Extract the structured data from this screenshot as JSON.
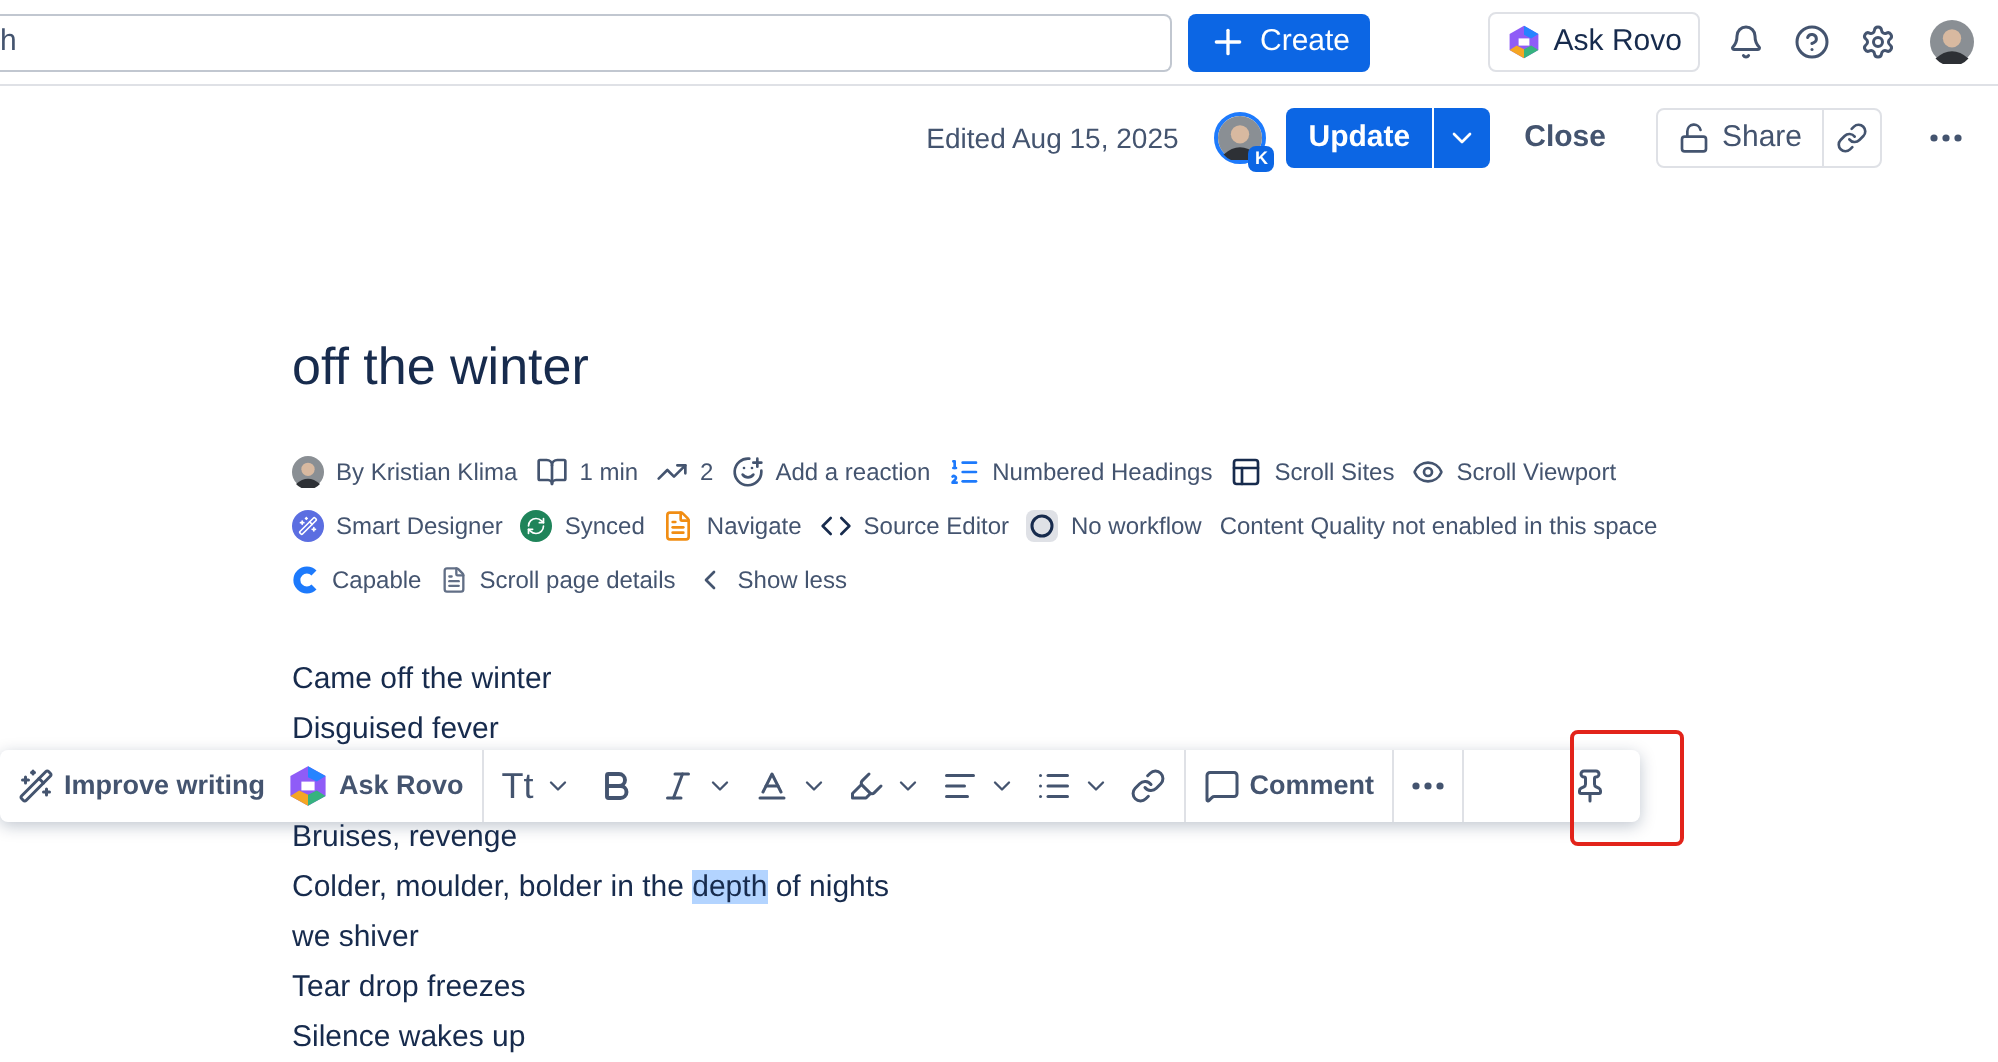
{
  "topbar": {
    "search": {
      "value": "h"
    },
    "create": "Create",
    "ask_rovo": "Ask Rovo"
  },
  "page_actions": {
    "edited": "Edited Aug 15, 2025",
    "avatar_badge": "K",
    "update": "Update",
    "close": "Close",
    "share": "Share"
  },
  "title": "off the winter",
  "meta_rows": [
    [
      {
        "kind": "avatar",
        "label": "By Kristian Klima"
      },
      {
        "kind": "read-time",
        "label": "1 min"
      },
      {
        "kind": "views",
        "label": "2"
      },
      {
        "kind": "reaction",
        "label": "Add a reaction"
      },
      {
        "kind": "headings",
        "label": "Numbered Headings"
      },
      {
        "kind": "sites",
        "label": "Scroll Sites"
      },
      {
        "kind": "viewport",
        "label": "Scroll Viewport"
      }
    ],
    [
      {
        "kind": "designer",
        "label": "Smart Designer"
      },
      {
        "kind": "synced",
        "label": "Synced"
      },
      {
        "kind": "navigate",
        "label": "Navigate"
      },
      {
        "kind": "source",
        "label": "Source Editor"
      },
      {
        "kind": "workflow",
        "label": "No workflow"
      },
      {
        "kind": "text",
        "label": "Content Quality not enabled in this space"
      }
    ],
    [
      {
        "kind": "capable",
        "label": "Capable"
      },
      {
        "kind": "details",
        "label": "Scroll page details"
      },
      {
        "kind": "less",
        "label": "Show less"
      }
    ]
  ],
  "body_above": [
    [
      {
        "text": "Came off the winter",
        "selected": false
      }
    ],
    [
      {
        "text": "Disguised fever",
        "selected": false
      }
    ]
  ],
  "body_below": [
    [
      {
        "text": "Bruises, revenge",
        "selected": false
      }
    ],
    [
      {
        "text": "Colder, moulder, bolder in the ",
        "selected": false
      },
      {
        "text": "depth",
        "selected": true
      },
      {
        "text": " of nights",
        "selected": false
      }
    ],
    [
      {
        "text": "we shiver",
        "selected": false
      }
    ],
    [
      {
        "text": "Tear drop freezes",
        "selected": false
      }
    ],
    [
      {
        "text": "Silence wakes up",
        "selected": false
      }
    ]
  ],
  "toolbar": [
    {
      "kind": "improve",
      "label": "Improve writing"
    },
    {
      "kind": "rovo",
      "label": "Ask Rovo"
    },
    {
      "kind": "text-style",
      "label": "Tt"
    },
    {
      "kind": "bold"
    },
    {
      "kind": "italic"
    },
    {
      "kind": "font-color"
    },
    {
      "kind": "highlight"
    },
    {
      "kind": "align"
    },
    {
      "kind": "list"
    },
    {
      "kind": "link"
    },
    {
      "kind": "comment",
      "label": "Comment"
    },
    {
      "kind": "more"
    },
    {
      "kind": "pin"
    }
  ]
}
